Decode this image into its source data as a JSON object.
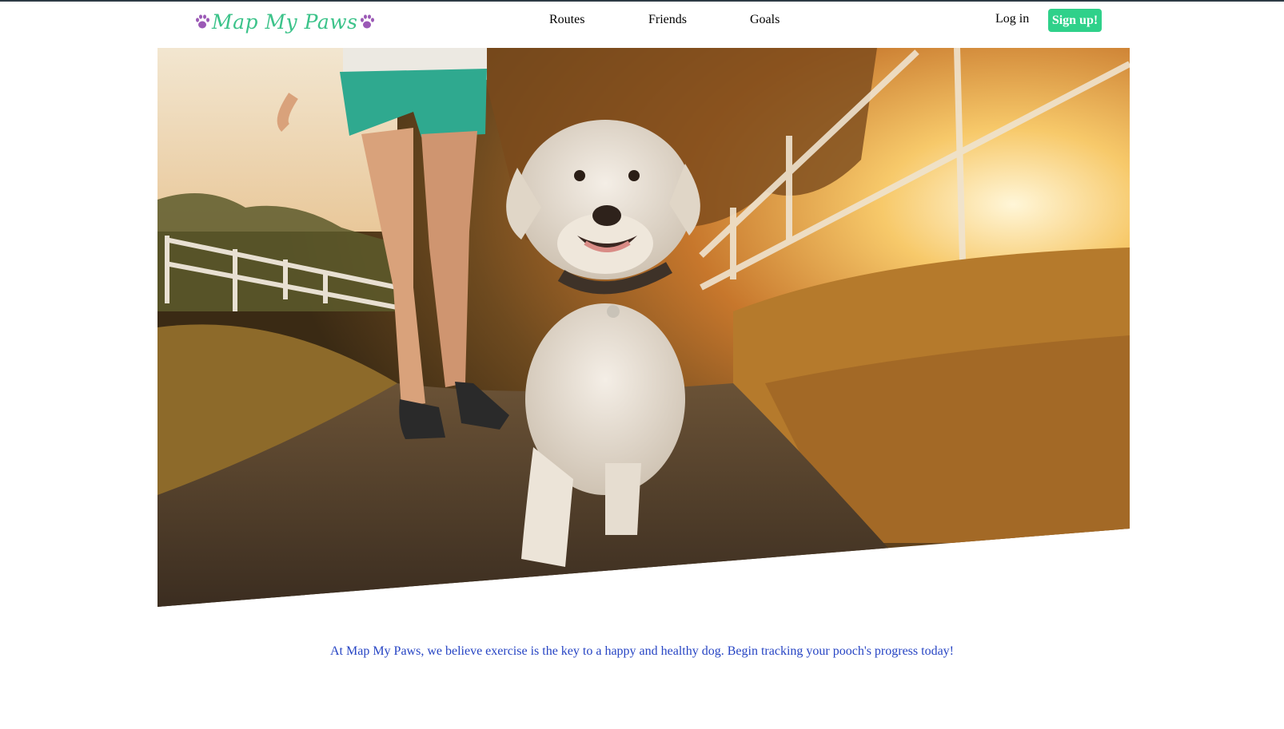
{
  "brand": {
    "name": "Map My Paws",
    "logo_color": "#3cc38a",
    "paw_color": "#9b59b6",
    "left_icon": "paw-icon",
    "right_icon": "paw-icon"
  },
  "nav": {
    "links": [
      {
        "label": "Routes"
      },
      {
        "label": "Friends"
      },
      {
        "label": "Goals"
      }
    ],
    "login_label": "Log in",
    "signup_label": "Sign up!",
    "signup_color": "#2fd18a"
  },
  "hero": {
    "image_semantic": "puppy walking on sunlit country path with owner"
  },
  "tagline": "At Map My Paws, we believe exercise is the key to a happy and healthy dog. Begin tracking your pooch's progress today!"
}
